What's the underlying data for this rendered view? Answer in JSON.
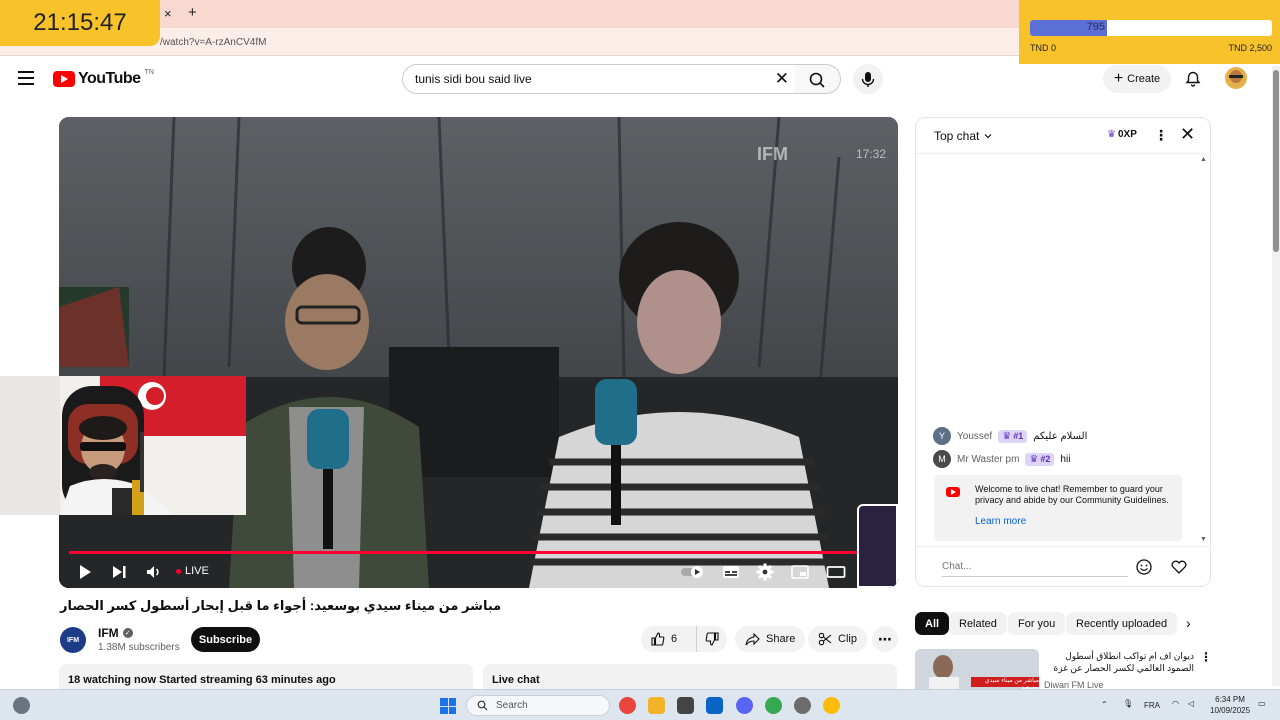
{
  "overlay": {
    "clock": "21:15:47",
    "goal": {
      "current": 795,
      "current_label": "795",
      "min_label": "TND 0",
      "max_label": "TND 2,500",
      "fraction": 0.318
    }
  },
  "browser": {
    "tab_close": "×",
    "new_tab": "+",
    "url": "/watch?v=A-rzAnCV4fM"
  },
  "header": {
    "logo_text": "YouTube",
    "logo_country": "TN",
    "search_query": "tunis sidi bou said live",
    "create_label": "Create"
  },
  "player": {
    "watermark": "IFM",
    "overlay_clock": "17:32",
    "live_label": "LIVE",
    "progress": 0.985
  },
  "video": {
    "title": "مباشر من ميناء سيدي بوسعيد: أجواء ما قبل إبحار أسطول كسر الحصار",
    "channel_avatar_text": "IFM",
    "channel": "IFM",
    "subscribers": "1.38M subscribers",
    "subscribe_label": "Subscribe",
    "likes": "6",
    "share_label": "Share",
    "clip_label": "Clip",
    "more_label": "⋯",
    "watching": "18 watching now  Started streaming 63 minutes ago",
    "live_chat_label": "Live chat"
  },
  "chat": {
    "mode": "Top chat",
    "xp": "0XP",
    "messages": [
      {
        "author": "Youssef",
        "badge": "#1",
        "text": "السلام عليكم",
        "avatar_letter": "Y",
        "avatar_color": "#5b6f86"
      },
      {
        "author": "Mr Waster pm",
        "badge": "#2",
        "text": "hii",
        "avatar_letter": "M",
        "avatar_color": "#4a4a4a"
      }
    ],
    "welcome": "Welcome to live chat! Remember to guard your privacy and abide by our Community Guidelines.",
    "learn_more": "Learn more",
    "input_placeholder": "Chat..."
  },
  "chips": [
    "All",
    "Related",
    "For you",
    "Recently uploaded"
  ],
  "related": {
    "title": "ديوان اف ام تواكب انطلاق أسطول الصمود العالمي لكسر الحصار عن غزة",
    "channel": "Diwan FM Live",
    "thumb_caption": "مباشر من ميناء سيدي بوسعيد"
  },
  "taskbar": {
    "search_label": "Search",
    "language": "FRA",
    "time": "6:34 PM",
    "date": "10/09/2025"
  },
  "colors": {
    "accent_red": "#ff0033",
    "overlay_yellow": "#f7c22a",
    "goal_fill": "#5b6fd6",
    "badge_purple": "#5b2fb5"
  }
}
